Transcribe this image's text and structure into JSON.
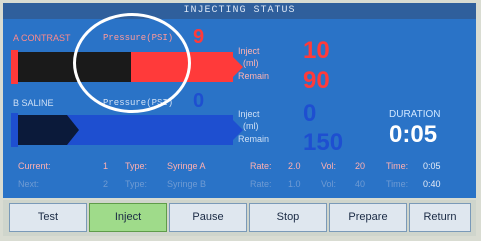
{
  "header": {
    "title": "INJECTING STATUS"
  },
  "syringe_a": {
    "name": "A CONTRAST",
    "pressure_label": "Pressure(PSI)",
    "pressure_value": "9",
    "inject_label": "Inject",
    "unit_label": "(ml)",
    "remain_label": "Remain",
    "inject_value": "10",
    "remain_value": "90",
    "fill_fraction": 0.1,
    "color": "#ff3a3a"
  },
  "syringe_b": {
    "name": "B SALINE",
    "pressure_label": "Pressure(PSI)",
    "pressure_value": "0",
    "inject_label": "Inject",
    "unit_label": "(ml)",
    "remain_label": "Remain",
    "inject_value": "0",
    "remain_value": "150",
    "fill_fraction": 0.0,
    "color": "#1e4fd0"
  },
  "duration": {
    "label": "DURATION",
    "value": "0:05"
  },
  "current_row": {
    "current_label": "Current:",
    "current_value": "1",
    "type_label": "Type:",
    "type_value": "Syringe A",
    "rate_label": "Rate:",
    "rate_value": "2.0",
    "vol_label": "Vol:",
    "vol_value": "20",
    "time_label": "Time:",
    "time_value": "0:05"
  },
  "next_row": {
    "next_label": "Next:",
    "next_value": "2",
    "type_label": "Type:",
    "type_value": "Syringe B",
    "rate_label": "Rate:",
    "rate_value": "1.0",
    "vol_label": "Vol:",
    "vol_value": "40",
    "time_label": "Time:",
    "time_value": "0:40"
  },
  "buttons": {
    "test": "Test",
    "inject": "Inject",
    "pause": "Pause",
    "stop": "Stop",
    "prepare": "Prepare",
    "return": "Return"
  },
  "colors": {
    "accent_red": "#ff3a3a",
    "accent_blue": "#1e4fd0",
    "panel_bg": "#2a73c7",
    "header_bg": "#2f5f9c",
    "active_button": "#9fdb8a"
  }
}
